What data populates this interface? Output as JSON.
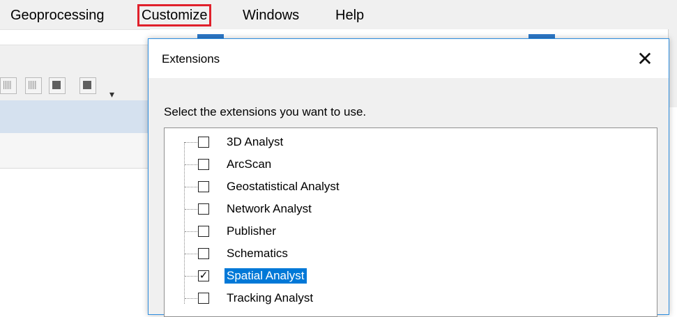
{
  "menubar": {
    "items": [
      {
        "label": "Geoprocessing",
        "highlighted": false
      },
      {
        "label": "Customize",
        "highlighted": true
      },
      {
        "label": "Windows",
        "highlighted": false
      },
      {
        "label": "Help",
        "highlighted": false
      }
    ]
  },
  "dialog": {
    "title": "Extensions",
    "close_glyph": "✕",
    "prompt": "Select the extensions you want to use.",
    "extensions": [
      {
        "label": "3D Analyst",
        "checked": false,
        "selected": false
      },
      {
        "label": "ArcScan",
        "checked": false,
        "selected": false
      },
      {
        "label": "Geostatistical Analyst",
        "checked": false,
        "selected": false
      },
      {
        "label": "Network Analyst",
        "checked": false,
        "selected": false
      },
      {
        "label": "Publisher",
        "checked": false,
        "selected": false
      },
      {
        "label": "Schematics",
        "checked": false,
        "selected": false
      },
      {
        "label": "Spatial Analyst",
        "checked": true,
        "selected": true
      },
      {
        "label": "Tracking Analyst",
        "checked": false,
        "selected": false
      }
    ]
  },
  "colors": {
    "highlight_outline": "#e0202b",
    "selection_bg": "#0078d7",
    "dialog_border": "#2c8ddf"
  }
}
